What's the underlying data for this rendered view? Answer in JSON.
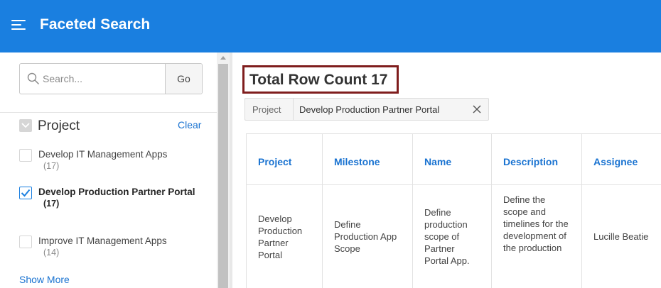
{
  "header": {
    "title": "Faceted Search"
  },
  "sidebar": {
    "search": {
      "placeholder": "Search...",
      "go_label": "Go"
    },
    "facet": {
      "title": "Project",
      "clear_label": "Clear",
      "items": [
        {
          "label": "Develop IT Management Apps",
          "count": "(17)",
          "checked": false
        },
        {
          "label": "Develop Production Partner Portal",
          "count": "(17)",
          "checked": true
        },
        {
          "label": "Improve IT Management Apps",
          "count": "(14)",
          "checked": false
        }
      ],
      "show_more_label": "Show More"
    }
  },
  "main": {
    "row_count_label": "Total Row Count 17",
    "filter_chip": {
      "key": "Project",
      "value": "Develop Production Partner Portal"
    },
    "table": {
      "columns": [
        "Project",
        "Milestone",
        "Name",
        "Description",
        "Assignee"
      ],
      "rows": [
        {
          "project": "Develop Production Partner Portal",
          "milestone": "Define Production App Scope",
          "name": "Define production scope of Partner Portal App.",
          "description": "Define the scope and timelines for the development of the production",
          "assignee": "Lucille Beatie"
        }
      ]
    }
  },
  "colors": {
    "header_bg": "#1a7fe0",
    "link": "#1a73d1",
    "highlight_border": "#7f1d1d"
  }
}
